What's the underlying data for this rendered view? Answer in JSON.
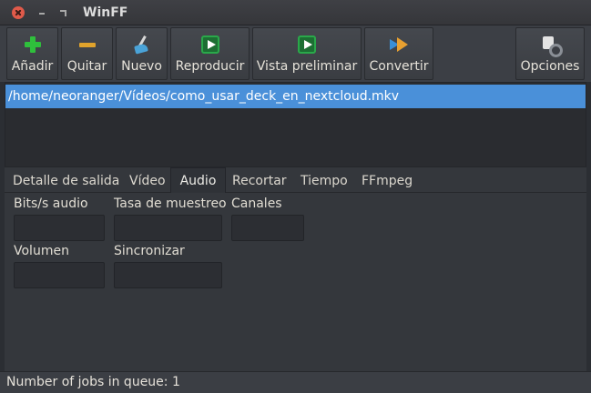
{
  "window": {
    "title": "WinFF"
  },
  "toolbar": {
    "add_label": "Añadir",
    "remove_label": "Quitar",
    "new_label": "Nuevo",
    "play_label": "Reproducir",
    "preview_label": "Vista preliminar",
    "convert_label": "Convertir",
    "options_label": "Opciones"
  },
  "files": {
    "items": [
      "/home/neoranger/Vídeos/como_usar_deck_en_nextcloud.mkv"
    ]
  },
  "tabs": {
    "output_details": "Detalle de salida",
    "video": "Vídeo",
    "audio": "Audio",
    "crop": "Recortar",
    "time": "Tiempo",
    "ffmpeg": "FFmpeg",
    "active": "Audio"
  },
  "audio_panel": {
    "bitrate_label": "Bits/s audio",
    "bitrate_value": "",
    "samplerate_label": "Tasa de muestreo",
    "samplerate_value": "",
    "channels_label": "Canales",
    "channels_value": "",
    "volume_label": "Volumen",
    "volume_value": "",
    "sync_label": "Sincronizar",
    "sync_value": ""
  },
  "status": {
    "text": "Number of jobs in queue: 1"
  },
  "colors": {
    "selection": "#4a90d9",
    "close_button": "#e05a4a",
    "add_icon": "#2fbf3c",
    "remove_icon": "#e0a32c"
  }
}
